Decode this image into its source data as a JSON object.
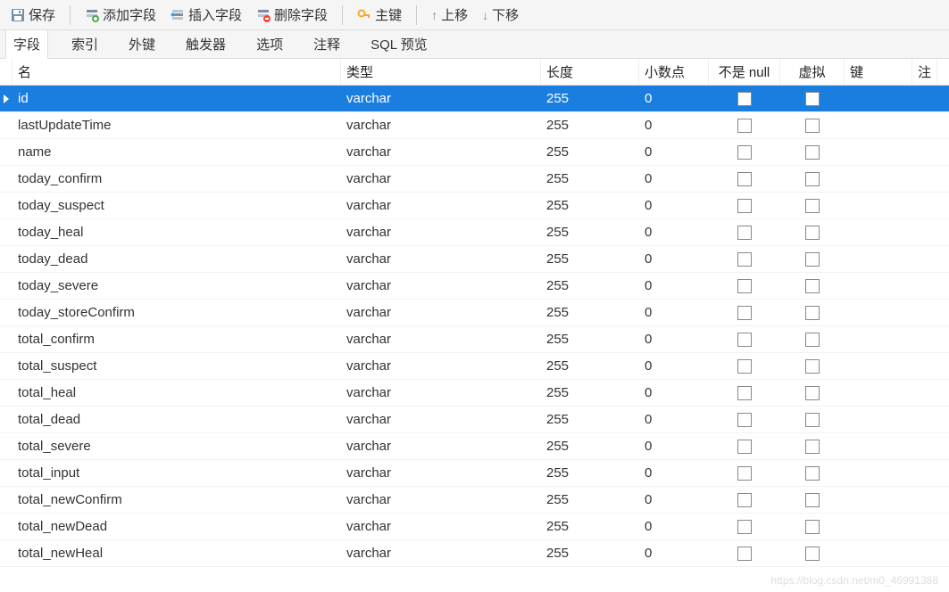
{
  "toolbar": {
    "save": "保存",
    "addField": "添加字段",
    "insertField": "插入字段",
    "deleteField": "删除字段",
    "primaryKey": "主键",
    "moveUp": "上移",
    "moveDown": "下移"
  },
  "tabs": [
    {
      "label": "字段",
      "active": true
    },
    {
      "label": "索引",
      "active": false
    },
    {
      "label": "外键",
      "active": false
    },
    {
      "label": "触发器",
      "active": false
    },
    {
      "label": "选项",
      "active": false
    },
    {
      "label": "注释",
      "active": false
    },
    {
      "label": "SQL 预览",
      "active": false
    }
  ],
  "columns": {
    "name": "名",
    "type": "类型",
    "length": "长度",
    "decimals": "小数点",
    "notNull": "不是 null",
    "virtual": "虚拟",
    "key": "键",
    "note": "注"
  },
  "rows": [
    {
      "name": "id",
      "type": "varchar",
      "length": "255",
      "decimals": "0",
      "selected": true
    },
    {
      "name": "lastUpdateTime",
      "type": "varchar",
      "length": "255",
      "decimals": "0"
    },
    {
      "name": "name",
      "type": "varchar",
      "length": "255",
      "decimals": "0"
    },
    {
      "name": "today_confirm",
      "type": "varchar",
      "length": "255",
      "decimals": "0"
    },
    {
      "name": "today_suspect",
      "type": "varchar",
      "length": "255",
      "decimals": "0"
    },
    {
      "name": "today_heal",
      "type": "varchar",
      "length": "255",
      "decimals": "0"
    },
    {
      "name": "today_dead",
      "type": "varchar",
      "length": "255",
      "decimals": "0"
    },
    {
      "name": "today_severe",
      "type": "varchar",
      "length": "255",
      "decimals": "0"
    },
    {
      "name": "today_storeConfirm",
      "type": "varchar",
      "length": "255",
      "decimals": "0"
    },
    {
      "name": "total_confirm",
      "type": "varchar",
      "length": "255",
      "decimals": "0"
    },
    {
      "name": "total_suspect",
      "type": "varchar",
      "length": "255",
      "decimals": "0"
    },
    {
      "name": "total_heal",
      "type": "varchar",
      "length": "255",
      "decimals": "0"
    },
    {
      "name": "total_dead",
      "type": "varchar",
      "length": "255",
      "decimals": "0"
    },
    {
      "name": "total_severe",
      "type": "varchar",
      "length": "255",
      "decimals": "0"
    },
    {
      "name": "total_input",
      "type": "varchar",
      "length": "255",
      "decimals": "0"
    },
    {
      "name": "total_newConfirm",
      "type": "varchar",
      "length": "255",
      "decimals": "0"
    },
    {
      "name": "total_newDead",
      "type": "varchar",
      "length": "255",
      "decimals": "0"
    },
    {
      "name": "total_newHeal",
      "type": "varchar",
      "length": "255",
      "decimals": "0"
    }
  ],
  "watermark": "https://blog.csdn.net/m0_46991388"
}
